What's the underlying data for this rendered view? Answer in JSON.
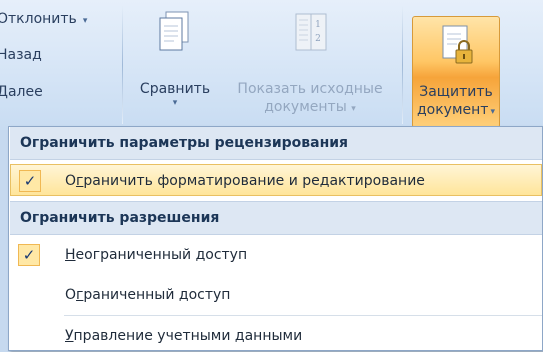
{
  "ribbon": {
    "left_items": [
      {
        "label": "Отклонить",
        "has_dropdown": true
      },
      {
        "label": "Назад",
        "has_dropdown": false
      },
      {
        "label": "Далее",
        "has_dropdown": false
      }
    ],
    "compare": {
      "label": "Сравнить",
      "dropdown_glyph": "▾",
      "icon": "compare-document-icon"
    },
    "show_source": {
      "line1": "Показать исходные",
      "line2": "документы",
      "dropdown_glyph": "▾",
      "icon": "source-documents-icon",
      "disabled": true,
      "panel_numbers": [
        "1",
        "2"
      ]
    },
    "protect": {
      "line1": "Защитить",
      "line2": "документ",
      "dropdown_glyph": "▾",
      "icon": "protect-document-lock-icon",
      "active": true
    },
    "dropdown_glyph": "▾"
  },
  "menu": {
    "section1_header": "Ограничить параметры рецензирования",
    "restrict_formatting": {
      "before": "О",
      "mnemonic": "г",
      "after": "раничить форматирование и редактирование",
      "checked": true,
      "highlighted": true
    },
    "section2_header": "Ограничить разрешения",
    "unrestricted": {
      "before": "",
      "mnemonic": "Н",
      "after": "еограниченный доступ",
      "checked": true
    },
    "restricted": {
      "before": "О",
      "mnemonic": "г",
      "after": "раниченный доступ",
      "checked": false
    },
    "manage_credentials": {
      "before": "",
      "mnemonic": "У",
      "after": "правление учетными данными",
      "checked": false
    },
    "check_glyph": "✓"
  },
  "colors": {
    "ribbon_bg": "#d9e7f7",
    "menu_header_bg": "#dde7f3",
    "highlight": "#ffe59a",
    "protect_button": "#f6a43a"
  }
}
